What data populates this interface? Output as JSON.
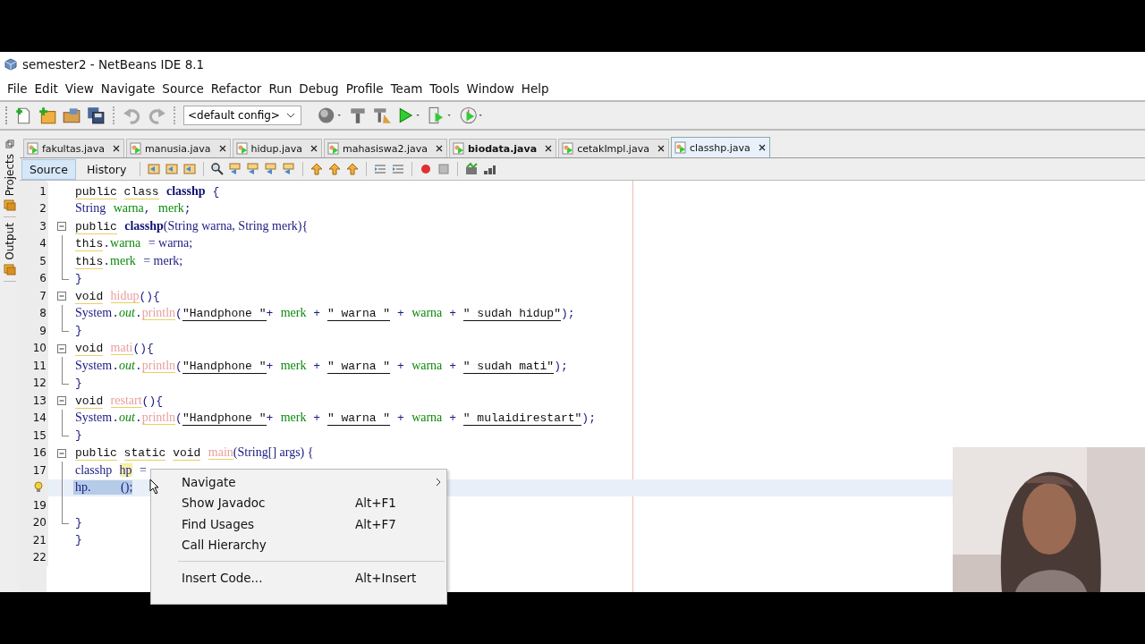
{
  "window": {
    "title": "semester2 - NetBeans IDE 8.1"
  },
  "menu": [
    "File",
    "Edit",
    "View",
    "Navigate",
    "Source",
    "Refactor",
    "Run",
    "Debug",
    "Profile",
    "Team",
    "Tools",
    "Window",
    "Help"
  ],
  "toolbar": {
    "config": "<default config>"
  },
  "side_panels": [
    "Projects",
    "Output"
  ],
  "tabs": [
    {
      "label": "fakultas.java",
      "selected": false,
      "modified": false
    },
    {
      "label": "manusia.java",
      "selected": false,
      "modified": false
    },
    {
      "label": "hidup.java",
      "selected": false,
      "modified": false
    },
    {
      "label": "mahasiswa2.java",
      "selected": false,
      "modified": false
    },
    {
      "label": "biodata.java",
      "selected": false,
      "modified": true
    },
    {
      "label": "cetakImpl.java",
      "selected": false,
      "modified": false
    },
    {
      "label": "classhp.java",
      "selected": true,
      "modified": false
    }
  ],
  "views": [
    {
      "label": "Source",
      "selected": true
    },
    {
      "label": "History",
      "selected": false
    }
  ],
  "code": [
    {
      "n": "1",
      "tokens": [
        {
          "t": "public",
          "kind": "kw"
        },
        {
          "t": "class",
          "kind": "kw",
          "gap": true
        },
        {
          "t": "classhp",
          "kind": "decl",
          "gap": true
        },
        {
          "t": "{",
          "kind": "punct",
          "gap": true
        }
      ]
    },
    {
      "n": "2",
      "tokens": [
        {
          "t": "String",
          "kind": "type"
        },
        {
          "t": "warna",
          "kind": "field",
          "gap": true
        },
        {
          "t": ",",
          "kind": "punct"
        },
        {
          "t": "merk",
          "kind": "field",
          "gap": true
        },
        {
          "t": ";",
          "kind": "punct"
        }
      ]
    },
    {
      "n": "3",
      "fold_start": true,
      "tokens": [
        {
          "t": "public",
          "kind": "kw"
        },
        {
          "t": "classhp",
          "kind": "decl",
          "gap": true
        },
        {
          "t": "(String warna, String merk){",
          "kind": "type"
        }
      ]
    },
    {
      "n": "4",
      "in_fold": true,
      "tokens": [
        {
          "t": "this",
          "kind": "kw"
        },
        {
          "t": ".",
          "kind": "punct"
        },
        {
          "t": "warna",
          "kind": "field"
        },
        {
          "t": "= warna;",
          "kind": "type",
          "gap": true
        }
      ]
    },
    {
      "n": "5",
      "in_fold": true,
      "tokens": [
        {
          "t": "this",
          "kind": "kw"
        },
        {
          "t": ".",
          "kind": "punct"
        },
        {
          "t": "merk",
          "kind": "field"
        },
        {
          "t": "= merk;",
          "kind": "type",
          "gap": true
        }
      ]
    },
    {
      "n": "6",
      "fold_end": true,
      "tokens": [
        {
          "t": "}",
          "kind": "punct"
        }
      ]
    },
    {
      "n": "7",
      "fold_start": true,
      "tokens": [
        {
          "t": "void",
          "kind": "kw"
        },
        {
          "t": "hidup",
          "kind": "method",
          "gap": true
        },
        {
          "t": "(){",
          "kind": "punct"
        }
      ]
    },
    {
      "n": "8",
      "in_fold": true,
      "tokens": [
        {
          "t": "System",
          "kind": "type"
        },
        {
          "t": ".",
          "kind": "punct"
        },
        {
          "t": "out",
          "kind": "static"
        },
        {
          "t": ".",
          "kind": "punct"
        },
        {
          "t": "println",
          "kind": "method"
        },
        {
          "t": "(",
          "kind": "punct"
        },
        {
          "t": "\"Handphone \"",
          "kind": "str"
        },
        {
          "t": "+",
          "kind": "punct"
        },
        {
          "t": "merk",
          "kind": "field",
          "gap": true
        },
        {
          "t": "+",
          "kind": "punct",
          "gap": true
        },
        {
          "t": "\" warna \"",
          "kind": "str",
          "gap": true
        },
        {
          "t": "+",
          "kind": "punct",
          "gap": true
        },
        {
          "t": "warna",
          "kind": "field",
          "gap": true
        },
        {
          "t": "+",
          "kind": "punct",
          "gap": true
        },
        {
          "t": "\" sudah hidup\"",
          "kind": "str",
          "gap": true
        },
        {
          "t": ");",
          "kind": "punct"
        }
      ]
    },
    {
      "n": "9",
      "fold_end": true,
      "tokens": [
        {
          "t": "}",
          "kind": "punct"
        }
      ]
    },
    {
      "n": "10",
      "fold_start": true,
      "tokens": [
        {
          "t": "void",
          "kind": "kw"
        },
        {
          "t": "mati",
          "kind": "method",
          "gap": true
        },
        {
          "t": "(){",
          "kind": "punct"
        }
      ]
    },
    {
      "n": "11",
      "in_fold": true,
      "tokens": [
        {
          "t": "System",
          "kind": "type"
        },
        {
          "t": ".",
          "kind": "punct"
        },
        {
          "t": "out",
          "kind": "static"
        },
        {
          "t": ".",
          "kind": "punct"
        },
        {
          "t": "println",
          "kind": "method"
        },
        {
          "t": "(",
          "kind": "punct"
        },
        {
          "t": "\"Handphone \"",
          "kind": "str"
        },
        {
          "t": "+",
          "kind": "punct"
        },
        {
          "t": "merk",
          "kind": "field",
          "gap": true
        },
        {
          "t": "+",
          "kind": "punct",
          "gap": true
        },
        {
          "t": "\" warna \"",
          "kind": "str",
          "gap": true
        },
        {
          "t": "+",
          "kind": "punct",
          "gap": true
        },
        {
          "t": "warna",
          "kind": "field",
          "gap": true
        },
        {
          "t": "+",
          "kind": "punct",
          "gap": true
        },
        {
          "t": "\" sudah mati\"",
          "kind": "str",
          "gap": true
        },
        {
          "t": ");",
          "kind": "punct"
        }
      ]
    },
    {
      "n": "12",
      "fold_end": true,
      "tokens": [
        {
          "t": "}",
          "kind": "punct"
        }
      ]
    },
    {
      "n": "13",
      "fold_start": true,
      "tokens": [
        {
          "t": "void",
          "kind": "kw"
        },
        {
          "t": "restart",
          "kind": "method",
          "gap": true
        },
        {
          "t": "(){",
          "kind": "punct"
        }
      ]
    },
    {
      "n": "14",
      "in_fold": true,
      "tokens": [
        {
          "t": "System",
          "kind": "type"
        },
        {
          "t": ".",
          "kind": "punct"
        },
        {
          "t": "out",
          "kind": "static"
        },
        {
          "t": ".",
          "kind": "punct"
        },
        {
          "t": "println",
          "kind": "method"
        },
        {
          "t": "(",
          "kind": "punct"
        },
        {
          "t": "\"Handphone \"",
          "kind": "str"
        },
        {
          "t": "+",
          "kind": "punct"
        },
        {
          "t": "merk",
          "kind": "field",
          "gap": true
        },
        {
          "t": "+",
          "kind": "punct",
          "gap": true
        },
        {
          "t": "\" warna \"",
          "kind": "str",
          "gap": true
        },
        {
          "t": "+",
          "kind": "punct",
          "gap": true
        },
        {
          "t": "warna",
          "kind": "field",
          "gap": true
        },
        {
          "t": "+",
          "kind": "punct",
          "gap": true
        },
        {
          "t": "\" mulaidirestart\"",
          "kind": "str",
          "gap": true
        },
        {
          "t": ");",
          "kind": "punct"
        }
      ]
    },
    {
      "n": "15",
      "fold_end": true,
      "tokens": [
        {
          "t": "}",
          "kind": "punct"
        }
      ]
    },
    {
      "n": "16",
      "fold_start": true,
      "tokens": [
        {
          "t": "public",
          "kind": "kw"
        },
        {
          "t": "static",
          "kind": "kw",
          "gap": true
        },
        {
          "t": "void",
          "kind": "kw",
          "gap": true
        },
        {
          "t": "main",
          "kind": "method",
          "gap": true
        },
        {
          "t": "(String[] args) {",
          "kind": "type"
        }
      ]
    },
    {
      "n": "17",
      "in_fold": true,
      "tokens": [
        {
          "t": "classhp",
          "kind": "type"
        },
        {
          "t": "hp",
          "kind": "mark",
          "gap": true
        },
        {
          "t": "=",
          "kind": "type",
          "gap": true
        }
      ]
    },
    {
      "in_fold": true,
      "selected": true,
      "hint": true,
      "tokens": [
        {
          "t": "hp.",
          "kind": "type"
        },
        {
          "t": "();",
          "kind": "type",
          "wide_gap": true
        }
      ]
    },
    {
      "n": "19",
      "in_fold": true
    },
    {
      "n": "20",
      "fold_end": true,
      "tokens": [
        {
          "t": "}",
          "kind": "punct"
        }
      ]
    },
    {
      "n": "21",
      "tokens": [
        {
          "t": "}",
          "kind": "punct"
        }
      ]
    },
    {
      "n": "22"
    }
  ],
  "context_menu": [
    {
      "kind": "submenu",
      "label": "Navigate"
    },
    {
      "kind": "item",
      "label": "Show Javadoc",
      "shortcut": "Alt+F1"
    },
    {
      "kind": "item",
      "label": "Find Usages",
      "shortcut": "Alt+F7"
    },
    {
      "kind": "item",
      "label": "Call Hierarchy"
    },
    {
      "kind": "separator"
    },
    {
      "kind": "item",
      "label": "Insert Code...",
      "shortcut": "Alt+Insert"
    }
  ],
  "webcam": {
    "kind": "picture"
  }
}
